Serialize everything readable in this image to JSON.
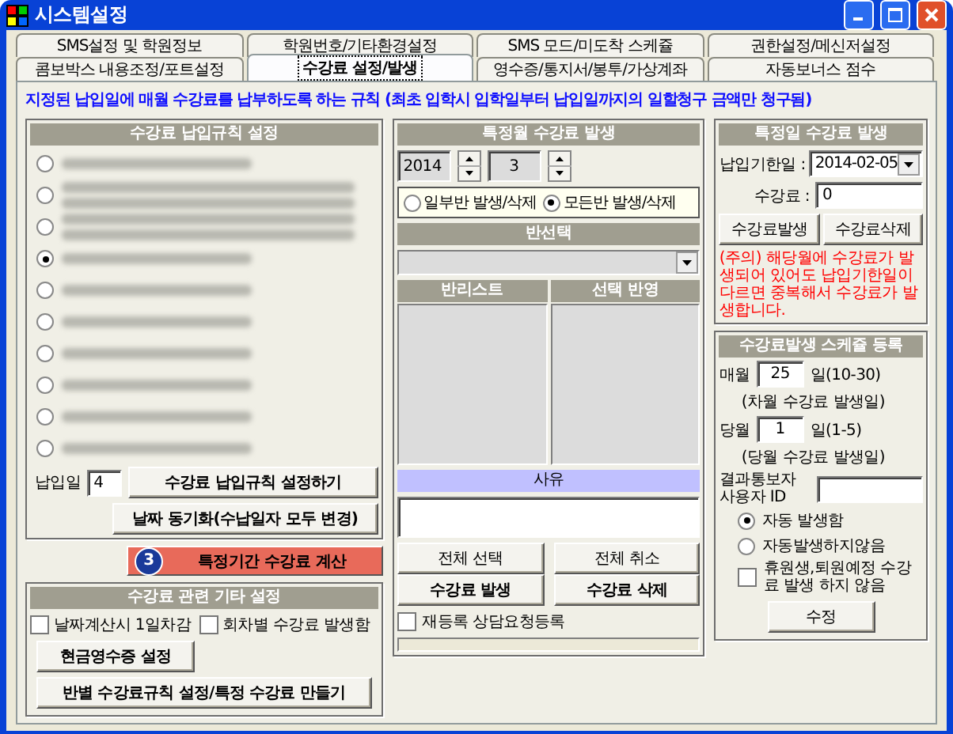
{
  "window": {
    "title": "시스템설정"
  },
  "tabs_back": [
    {
      "label": "SMS설정 및 학원정보",
      "selected": false
    },
    {
      "label": "학원번호/기타환경설정",
      "selected": false
    },
    {
      "label": "SMS 모드/미도착 스케쥴",
      "selected": false
    },
    {
      "label": "권한설정/메신저설정",
      "selected": false
    }
  ],
  "tabs_front": [
    {
      "label": "콤보박스 내용조정/포트설정",
      "selected": false
    },
    {
      "label": "수강료 설정/발생",
      "selected": true
    },
    {
      "label": "영수증/통지서/봉투/가상계좌",
      "selected": false
    },
    {
      "label": "자동보너스 점수",
      "selected": false
    }
  ],
  "rule_text": "지정된 납입일에 매월 수강료를 납부하도록 하는 규칙 (최초 입학시 입학일부터 납입일까지의 일할청구 금액만 청구됨)",
  "rule_panel": {
    "title": "수강료 납입규칙 설정",
    "options": [
      {
        "selected": false,
        "kind": "single"
      },
      {
        "selected": false,
        "kind": "double"
      },
      {
        "selected": false,
        "kind": "double"
      },
      {
        "selected": true,
        "kind": "single"
      },
      {
        "selected": false,
        "kind": "single"
      },
      {
        "selected": false,
        "kind": "single"
      },
      {
        "selected": false,
        "kind": "single"
      },
      {
        "selected": false,
        "kind": "single"
      },
      {
        "selected": false,
        "kind": "single"
      },
      {
        "selected": false,
        "kind": "single"
      }
    ],
    "day_label": "납입일",
    "day_value": "4",
    "set_button": "수강료 납입규칙 설정하기",
    "sync_button": "날짜 동기화(수납일자 모두 변경)"
  },
  "step_badge": "3",
  "period_button": "특정기간 수강료 계산",
  "etc_panel": {
    "title": "수강료 관련 기타 설정",
    "checks": [
      {
        "label": "날짜계산시 1일차감",
        "checked": false
      },
      {
        "label": "회차별 수강료 발생함",
        "checked": false
      }
    ],
    "receipt_button": "현금영수증 설정",
    "class_button": "반별 수강료규칙 설정/특정 수강료 만들기"
  },
  "month_panel": {
    "title": "특정월 수강료 발생",
    "year": "2014",
    "month": "3",
    "modes": [
      {
        "label": "일부반 발생/삭제",
        "selected": false
      },
      {
        "label": "모든반 발생/삭제",
        "selected": true
      }
    ],
    "class_select_title": "반선택",
    "list_title": "반리스트",
    "selected_title": "선택 반영",
    "reason_title": "사유",
    "select_all": "전체 선택",
    "create": "수강료 발생",
    "cancel_all": "전체 취소",
    "delete": "수강료 삭제",
    "reregister": {
      "label": "재등록 상담요청등록",
      "checked": false
    },
    "progress": {
      "level": 0
    }
  },
  "day_panel": {
    "title": "특정일 수강료 발생",
    "due_label": "납입기한일 :",
    "due_value": "2014-02-05",
    "fee_label": "수강료 :",
    "fee_value": "0",
    "create": "수강료발생",
    "delete": "수강료삭제",
    "note": "(주의) 해당월에 수강료가 발생되어 있어도 납입기한일이 다르면 중복해서 수강료가 발생합니다."
  },
  "schedule_panel": {
    "title": "수강료발생 스케쥴 등록",
    "monthly_label": "매월",
    "monthly_value": "25",
    "monthly_range": "일(10-30)",
    "monthly_note": "(차월 수강료 발생일)",
    "current_label": "당월",
    "current_value": "1",
    "current_range": "일(1-5)",
    "current_note": "(당월 수강료 발생일)",
    "user_label": "결과통보자 사용자 ID",
    "modes": [
      {
        "label": "자동 발생함",
        "selected": true
      },
      {
        "label": "자동발생하지않음",
        "selected": false
      }
    ],
    "skip": {
      "label": "휴원생,퇴원예정 수강료 발생 하지 않음",
      "checked": false
    },
    "save": "수정"
  }
}
